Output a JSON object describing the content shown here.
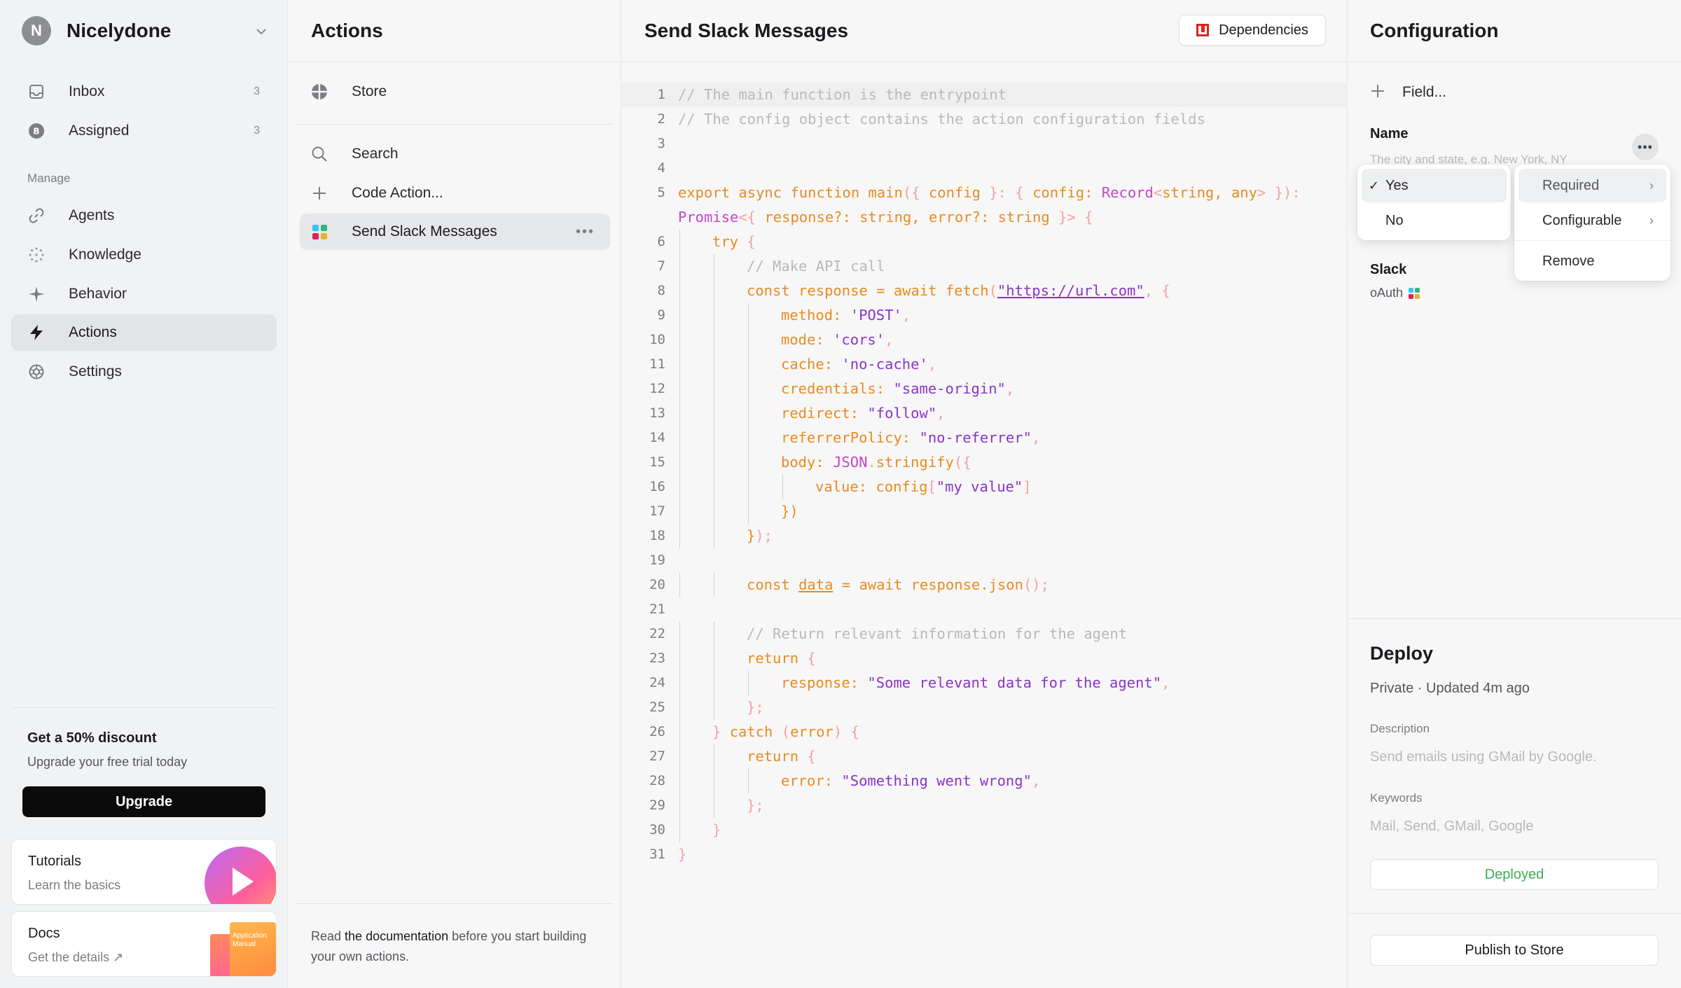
{
  "workspace": {
    "initial": "N",
    "name": "Nicelydone"
  },
  "nav": {
    "top": [
      {
        "label": "Inbox",
        "count": "3",
        "icon": "inbox-icon"
      },
      {
        "label": "Assigned",
        "count": "3",
        "icon": "assigned-icon"
      }
    ],
    "section_label": "Manage",
    "manage": [
      {
        "label": "Agents",
        "icon": "link-icon"
      },
      {
        "label": "Knowledge",
        "icon": "knowledge-icon"
      },
      {
        "label": "Behavior",
        "icon": "sparkle-icon"
      },
      {
        "label": "Actions",
        "icon": "bolt-icon",
        "active": true
      },
      {
        "label": "Settings",
        "icon": "settings-icon"
      }
    ]
  },
  "promo": {
    "title": "Get a 50% discount",
    "subtitle": "Upgrade your free trial today",
    "button": "Upgrade"
  },
  "cards": {
    "tutorials": {
      "title": "Tutorials",
      "subtitle": "Learn the basics"
    },
    "docs": {
      "title": "Docs",
      "subtitle": "Get the details ↗",
      "art_text": "Application Manual"
    }
  },
  "actions_panel": {
    "title": "Actions",
    "store_label": "Store",
    "search_label": "Search",
    "code_action_label": "Code Action...",
    "selected_label": "Send Slack Messages",
    "footer_pre": "Read ",
    "footer_link": "the documentation",
    "footer_post": " before you start building your own actions."
  },
  "editor": {
    "title": "Send Slack Messages",
    "dependencies_button": "Dependencies"
  },
  "code_lines": [
    {
      "n": "1",
      "indent": 0,
      "tokens": [
        [
          "c",
          "// The main function is the entrypoint"
        ]
      ]
    },
    {
      "n": "2",
      "indent": 0,
      "tokens": [
        [
          "c",
          "// The config object contains the action configuration fields"
        ]
      ]
    },
    {
      "n": "3",
      "indent": 0,
      "tokens": []
    },
    {
      "n": "4",
      "indent": 0,
      "tokens": []
    },
    {
      "n": "5",
      "indent": 0,
      "tokens": [
        [
          "k",
          "export async function main"
        ],
        [
          "p",
          "({ "
        ],
        [
          "k",
          "config "
        ],
        [
          "p",
          "}: { "
        ],
        [
          "k",
          "config: "
        ],
        [
          "t",
          "Record"
        ],
        [
          "p",
          "<"
        ],
        [
          "k",
          "string, any"
        ],
        [
          "p",
          "> }):"
        ]
      ]
    },
    {
      "n": "",
      "indent": 0,
      "tokens": [
        [
          "t",
          "Promise"
        ],
        [
          "p",
          "<{ "
        ],
        [
          "k",
          "response?: string, error?: string "
        ],
        [
          "p",
          "}> {"
        ]
      ]
    },
    {
      "n": "6",
      "indent": 1,
      "tokens": [
        [
          "k",
          "try "
        ],
        [
          "p",
          "{"
        ]
      ]
    },
    {
      "n": "7",
      "indent": 2,
      "tokens": [
        [
          "c",
          "// Make API call"
        ]
      ]
    },
    {
      "n": "8",
      "indent": 2,
      "tokens": [
        [
          "k",
          "const response = await fetch"
        ],
        [
          "p",
          "("
        ],
        [
          "u",
          "\"https://url.com\""
        ],
        [
          "p",
          ", {"
        ]
      ]
    },
    {
      "n": "9",
      "indent": 3,
      "tokens": [
        [
          "k",
          "method: "
        ],
        [
          "s",
          "'POST'"
        ],
        [
          "p",
          ","
        ]
      ]
    },
    {
      "n": "10",
      "indent": 3,
      "tokens": [
        [
          "k",
          "mode: "
        ],
        [
          "s",
          "'cors'"
        ],
        [
          "p",
          ","
        ]
      ]
    },
    {
      "n": "11",
      "indent": 3,
      "tokens": [
        [
          "k",
          "cache: "
        ],
        [
          "s",
          "'no-cache'"
        ],
        [
          "p",
          ","
        ]
      ]
    },
    {
      "n": "12",
      "indent": 3,
      "tokens": [
        [
          "k",
          "credentials: "
        ],
        [
          "s",
          "\"same-origin\""
        ],
        [
          "p",
          ","
        ]
      ]
    },
    {
      "n": "13",
      "indent": 3,
      "tokens": [
        [
          "k",
          "redirect: "
        ],
        [
          "s",
          "\"follow\""
        ],
        [
          "p",
          ","
        ]
      ]
    },
    {
      "n": "14",
      "indent": 3,
      "tokens": [
        [
          "k",
          "referrerPolicy: "
        ],
        [
          "s",
          "\"no-referrer\""
        ],
        [
          "p",
          ","
        ]
      ]
    },
    {
      "n": "15",
      "indent": 3,
      "tokens": [
        [
          "k",
          "body: "
        ],
        [
          "t",
          "JSON"
        ],
        [
          "p",
          "."
        ],
        [
          "k",
          "stringify"
        ],
        [
          "p",
          "({"
        ]
      ]
    },
    {
      "n": "16",
      "indent": 4,
      "tokens": [
        [
          "k",
          "value: config"
        ],
        [
          "p",
          "["
        ],
        [
          "s",
          "\"my value\""
        ],
        [
          "p",
          "]"
        ]
      ]
    },
    {
      "n": "17",
      "indent": 3,
      "tokens": [
        [
          "k",
          "})"
        ]
      ]
    },
    {
      "n": "18",
      "indent": 2,
      "tokens": [
        [
          "k",
          "}"
        ],
        [
          "p",
          ");"
        ]
      ]
    },
    {
      "n": "19",
      "indent": 0,
      "tokens": []
    },
    {
      "n": "20",
      "indent": 2,
      "tokens": [
        [
          "k",
          "const "
        ],
        [
          "d",
          "data"
        ],
        [
          "k",
          " = await response.json"
        ],
        [
          "p",
          "();"
        ]
      ]
    },
    {
      "n": "21",
      "indent": 0,
      "tokens": []
    },
    {
      "n": "22",
      "indent": 2,
      "tokens": [
        [
          "c",
          "// Return relevant information for the agent"
        ]
      ]
    },
    {
      "n": "23",
      "indent": 2,
      "tokens": [
        [
          "k",
          "return "
        ],
        [
          "p",
          "{"
        ]
      ]
    },
    {
      "n": "24",
      "indent": 3,
      "tokens": [
        [
          "k",
          "response: "
        ],
        [
          "s",
          "\"Some relevant data for the agent\""
        ],
        [
          "p",
          ","
        ]
      ]
    },
    {
      "n": "25",
      "indent": 2,
      "tokens": [
        [
          "p",
          "};"
        ]
      ]
    },
    {
      "n": "26",
      "indent": 1,
      "tokens": [
        [
          "p",
          "} "
        ],
        [
          "k",
          "catch "
        ],
        [
          "p",
          "("
        ],
        [
          "k",
          "error"
        ],
        [
          "p",
          ") {"
        ]
      ]
    },
    {
      "n": "27",
      "indent": 2,
      "tokens": [
        [
          "k",
          "return "
        ],
        [
          "p",
          "{"
        ]
      ]
    },
    {
      "n": "28",
      "indent": 3,
      "tokens": [
        [
          "k",
          "error: "
        ],
        [
          "s",
          "\"Something went wrong\""
        ],
        [
          "p",
          ","
        ]
      ]
    },
    {
      "n": "29",
      "indent": 2,
      "tokens": [
        [
          "p",
          "};"
        ]
      ]
    },
    {
      "n": "30",
      "indent": 1,
      "tokens": [
        [
          "p",
          "}"
        ]
      ]
    },
    {
      "n": "31",
      "indent": 0,
      "tokens": [
        [
          "p",
          "}"
        ]
      ]
    }
  ],
  "config": {
    "title": "Configuration",
    "add_field": "Field...",
    "field": {
      "name": "Name",
      "placeholder": "The city and state, e.g. New York, NY"
    },
    "choice_menu": [
      {
        "label": "Yes",
        "checked": true
      },
      {
        "label": "No",
        "checked": false
      }
    ],
    "options_menu": {
      "required": "Required",
      "configurable": "Configurable",
      "remove": "Remove"
    },
    "integration": {
      "name": "Slack",
      "auth": "oAuth"
    }
  },
  "deploy": {
    "title": "Deploy",
    "status": "Private · Updated 4m ago",
    "description_label": "Description",
    "description_value": "Send emails using GMail by Google.",
    "keywords_label": "Keywords",
    "keywords_value": "Mail, Send, GMail, Google",
    "deployed_button": "Deployed",
    "publish_button": "Publish to Store"
  },
  "colors": {
    "deployed_green": "#3fae54",
    "dependency_red": "#d9261c",
    "slack": [
      "#36c5f0",
      "#2eb67d",
      "#ecb22e",
      "#e01e5a"
    ]
  }
}
